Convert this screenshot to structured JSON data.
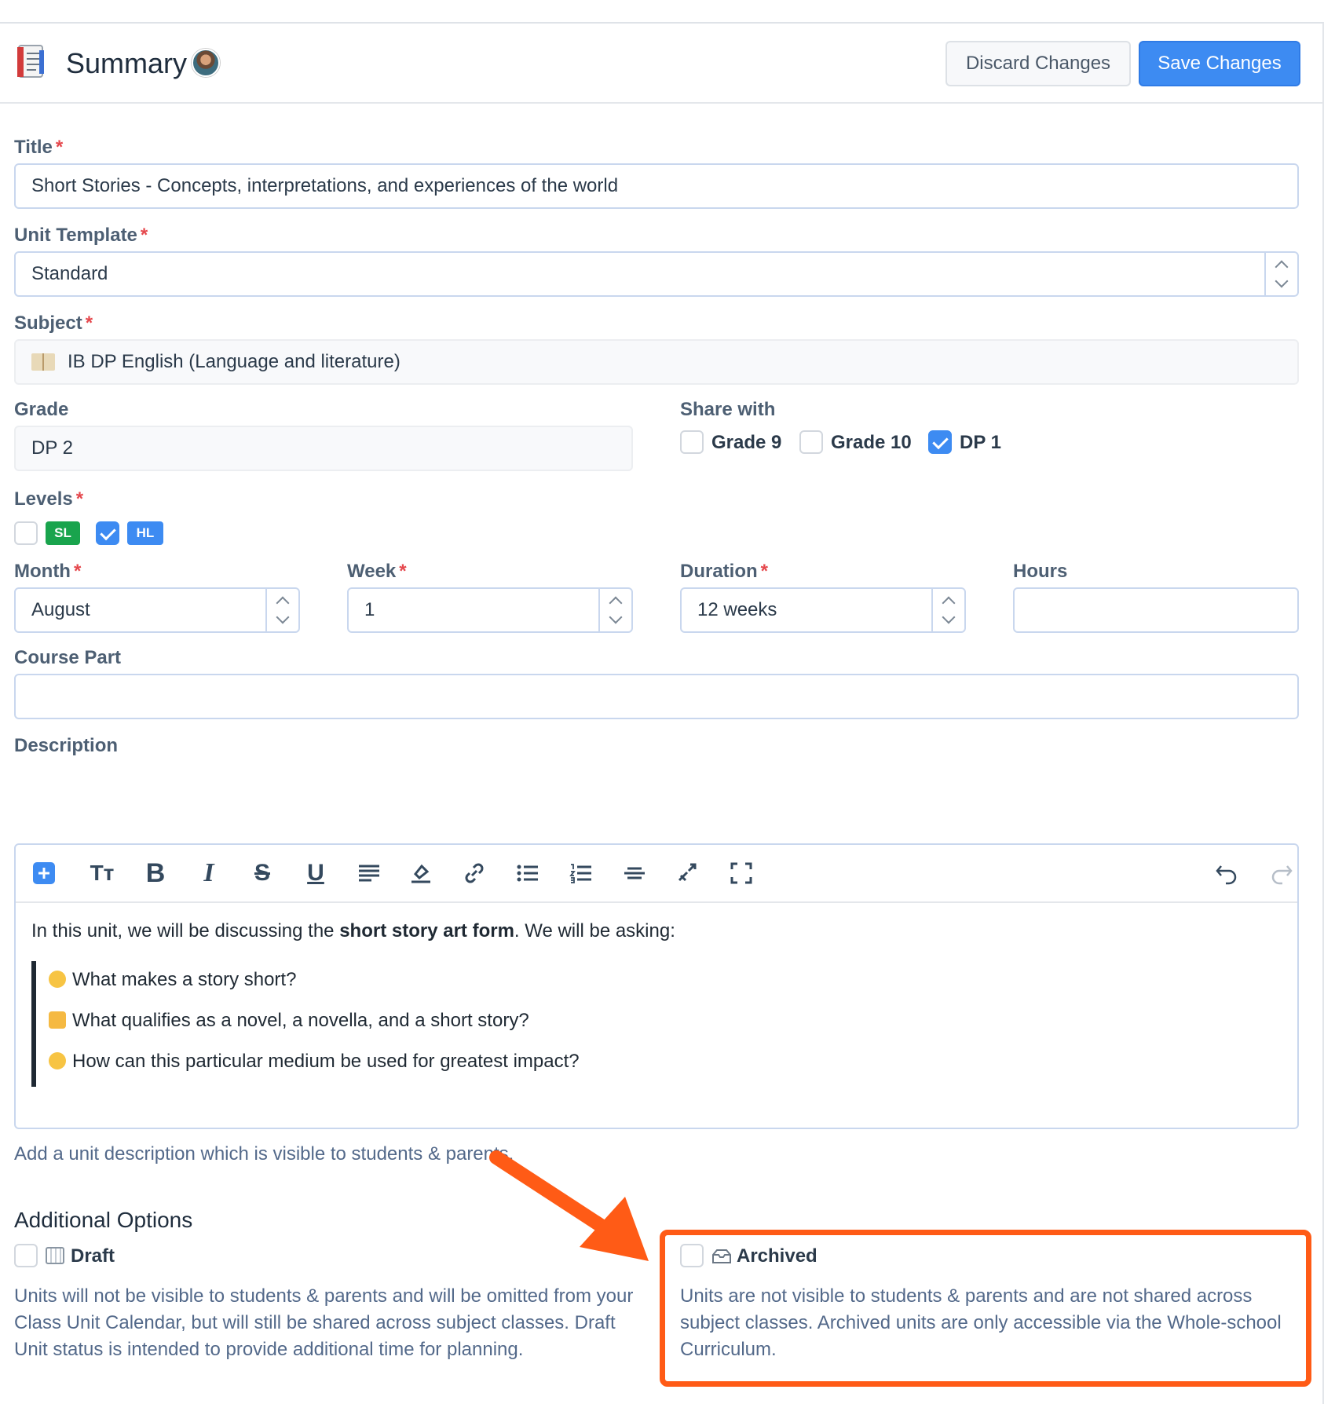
{
  "header": {
    "title": "Summary",
    "discard_label": "Discard Changes",
    "save_label": "Save Changes"
  },
  "form": {
    "title": {
      "label": "Title",
      "required": "*",
      "value": "Short Stories - Concepts, interpretations, and experiences of the world"
    },
    "unit_template": {
      "label": "Unit Template",
      "required": "*",
      "value": "Standard"
    },
    "subject": {
      "label": "Subject",
      "required": "*",
      "value": "IB DP English (Language and literature)"
    },
    "grade": {
      "label": "Grade",
      "value": "DP 2"
    },
    "share_with": {
      "label": "Share with",
      "options": [
        {
          "label": "Grade 9",
          "checked": false
        },
        {
          "label": "Grade 10",
          "checked": false
        },
        {
          "label": "DP 1",
          "checked": true
        }
      ]
    },
    "levels": {
      "label": "Levels",
      "required": "*",
      "options": [
        {
          "label": "SL",
          "checked": false,
          "color": "#19a44d"
        },
        {
          "label": "HL",
          "checked": true,
          "color": "#3d8bf2"
        }
      ]
    },
    "month": {
      "label": "Month",
      "required": "*",
      "value": "August"
    },
    "week": {
      "label": "Week",
      "required": "*",
      "value": "1"
    },
    "duration": {
      "label": "Duration",
      "required": "*",
      "value": "12 weeks"
    },
    "hours": {
      "label": "Hours",
      "value": ""
    },
    "course_part": {
      "label": "Course Part",
      "value": ""
    },
    "description": {
      "label": "Description",
      "toolbar": [
        "add-icon",
        "text-size-icon",
        "bold-icon",
        "italic-icon",
        "strikethrough-icon",
        "underline-icon",
        "align-icon",
        "highlight-icon",
        "link-icon",
        "bullet-list-icon",
        "numbered-list-icon",
        "horizontal-rule-icon",
        "clear-format-icon",
        "fullscreen-icon",
        "undo-icon",
        "redo-icon"
      ],
      "intro_before": "In this unit, we will be discussing the ",
      "intro_bold": "short story art form",
      "intro_after": ". We will be asking:",
      "questions": [
        {
          "emoji": "thinking-face-icon",
          "text": "What makes a story short?"
        },
        {
          "emoji": "writing-hand-icon",
          "text": "What qualifies as a novel, a novella, and a short story?"
        },
        {
          "emoji": "pleading-face-icon",
          "text": "How can this particular medium be used for greatest impact?"
        }
      ],
      "help": "Add a unit description which is visible to students & parents."
    }
  },
  "additional_options": {
    "title": "Additional Options",
    "draft": {
      "label": "Draft",
      "checked": false,
      "description": "Units will not be visible to students & parents and will be omitted from your Class Unit Calendar, but will still be shared across subject classes. Draft Unit status is intended to provide additional time for planning."
    },
    "archived": {
      "label": "Archived",
      "checked": false,
      "description": "Units are not visible to students & parents and are not shared across subject classes. Archived units are only accessible via the Whole-school Curriculum."
    }
  },
  "annotation": {
    "color": "#ff5b16"
  }
}
